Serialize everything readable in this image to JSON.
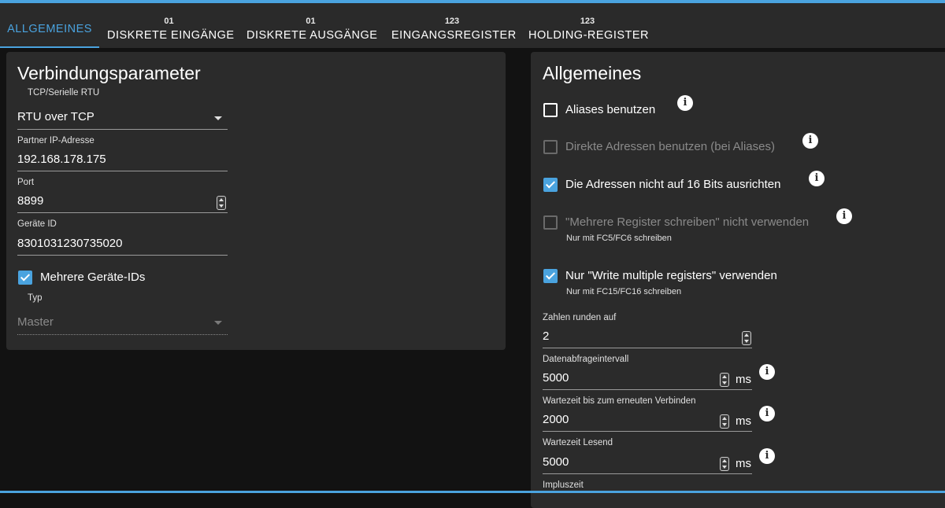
{
  "tabs": [
    {
      "count": "",
      "label": "ALLGEMEINES"
    },
    {
      "count": "01",
      "label": "DISKRETE EINGÄNGE"
    },
    {
      "count": "01",
      "label": "DISKRETE AUSGÄNGE"
    },
    {
      "count": "123",
      "label": "EINGANGSREGISTER"
    },
    {
      "count": "123",
      "label": "HOLDING-REGISTER"
    }
  ],
  "left": {
    "title": "Verbindungsparameter",
    "conn_type": {
      "label": "TCP/Serielle RTU",
      "value": "RTU over TCP"
    },
    "ip": {
      "label": "Partner IP-Adresse",
      "value": "192.168.178.175"
    },
    "port": {
      "label": "Port",
      "value": "8899"
    },
    "device_id": {
      "label": "Geräte ID",
      "value": "8301031230735020"
    },
    "multi_ids": {
      "label": "Mehrere Geräte-IDs",
      "checked": true
    },
    "typ": {
      "label": "Typ",
      "value": "Master"
    }
  },
  "right": {
    "title": "Allgemeines",
    "options": [
      {
        "label": "Aliases benutzen",
        "checked": false,
        "disabled": false,
        "help": ""
      },
      {
        "label": "Direkte Adressen benutzen (bei Aliases)",
        "checked": false,
        "disabled": true,
        "help": ""
      },
      {
        "label": "Die Adressen nicht auf 16 Bits ausrichten",
        "checked": true,
        "disabled": false,
        "help": ""
      },
      {
        "label": "\"Mehrere Register schreiben\" nicht verwenden",
        "checked": false,
        "disabled": true,
        "help": "Nur mit FC5/FC6 schreiben"
      },
      {
        "label": "Nur \"Write multiple registers\" verwenden",
        "checked": true,
        "disabled": false,
        "help": "Nur mit FC15/FC16 schreiben"
      }
    ],
    "round": {
      "label": "Zahlen runden auf",
      "value": "2"
    },
    "poll": {
      "label": "Datenabfrageintervall",
      "value": "5000",
      "unit": "ms"
    },
    "reconnect": {
      "label": "Wartezeit bis zum erneuten Verbinden",
      "value": "2000",
      "unit": "ms"
    },
    "read_wait": {
      "label": "Wartezeit Lesend",
      "value": "5000",
      "unit": "ms"
    },
    "pulse": {
      "label": "Impluszeit"
    }
  },
  "colors": {
    "accent": "#4aa3df",
    "panel": "#2b2b2b",
    "background": "#121212",
    "tabbar": "#2a2a2a"
  },
  "icons": {
    "info": "info-circle-icon",
    "checkbox_checked": "check-icon",
    "dropdown": "caret-down-icon",
    "spinner": "number-stepper-icon"
  }
}
